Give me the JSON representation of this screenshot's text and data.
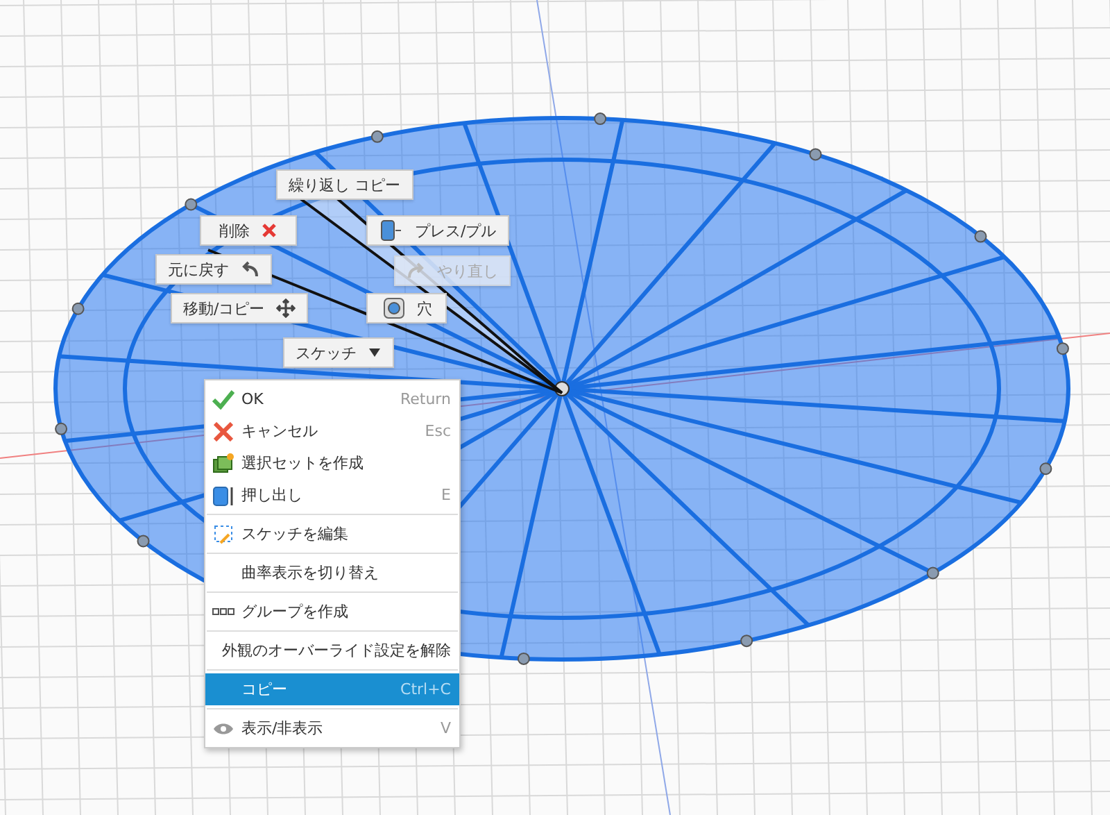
{
  "marking_menu": [
    {
      "label": "繰り返し コピー",
      "disabled": false
    },
    {
      "label": "削除",
      "disabled": false
    },
    {
      "label": "プレス/プル",
      "disabled": false
    },
    {
      "label": "元に戻す",
      "disabled": false
    },
    {
      "label": "やり直し",
      "disabled": true
    },
    {
      "label": "移動/コピー",
      "disabled": false
    },
    {
      "label": "穴",
      "disabled": false
    },
    {
      "label": "スケッチ",
      "disabled": false
    }
  ],
  "context_menu": {
    "groups": [
      [
        {
          "label": "OK",
          "shortcut": "Return",
          "selected": false
        },
        {
          "label": "キャンセル",
          "shortcut": "Esc",
          "selected": false
        },
        {
          "label": "選択セットを作成",
          "selected": false
        },
        {
          "label": "押し出し",
          "shortcut": "E",
          "selected": false
        }
      ],
      [
        {
          "label": "スケッチを編集",
          "selected": false
        }
      ],
      [
        {
          "label": "曲率表示を切り替え",
          "selected": false
        }
      ],
      [
        {
          "label": "グループを作成",
          "selected": false
        }
      ],
      [
        {
          "label": "外観のオーバーライド設定を解除",
          "selected": false
        }
      ],
      [
        {
          "label": "コピー",
          "shortcut": "Ctrl+C",
          "selected": true
        }
      ],
      [
        {
          "label": "表示/非表示",
          "shortcut": "V",
          "selected": false
        }
      ]
    ]
  }
}
